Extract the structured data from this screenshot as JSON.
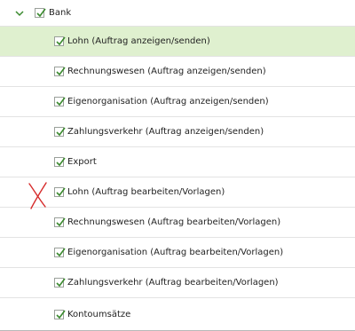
{
  "tree": {
    "root": {
      "label": "Bank",
      "expanded": true,
      "checked": true
    },
    "children": [
      {
        "label": "Lohn (Auftrag anzeigen/senden)",
        "checked": true,
        "selected": true
      },
      {
        "label": "Rechnungswesen (Auftrag anzeigen/senden)",
        "checked": true
      },
      {
        "label": "Eigenorganisation (Auftrag anzeigen/senden)",
        "checked": true
      },
      {
        "label": "Zahlungsverkehr (Auftrag anzeigen/senden)",
        "checked": true
      },
      {
        "label": "Export",
        "checked": true
      },
      {
        "label": "Lohn (Auftrag bearbeiten/Vorlagen)",
        "checked": true,
        "annotated": true
      },
      {
        "label": "Rechnungswesen (Auftrag bearbeiten/Vorlagen)",
        "checked": true
      },
      {
        "label": "Eigenorganisation (Auftrag bearbeiten/Vorlagen)",
        "checked": true
      },
      {
        "label": "Zahlungsverkehr (Auftrag bearbeiten/Vorlagen)",
        "checked": true
      },
      {
        "label": "Kontoumsätze",
        "checked": true
      }
    ]
  },
  "colors": {
    "check": "#3a8a2e",
    "selected_row": "#dff0cf",
    "annotation": "#d62b2b"
  },
  "icons": {
    "expand": "chevron-down-icon",
    "check": "checkmark-icon",
    "annotation": "red-x-mark"
  }
}
